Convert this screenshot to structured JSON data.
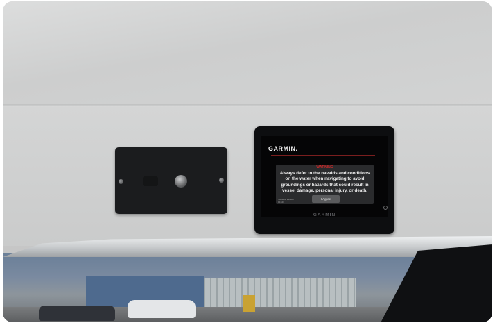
{
  "display": {
    "brand_top": "GARMIN.",
    "warning_title": "WARNING",
    "warning_text": "Always defer to the navaids and conditions on the water when navigating to avoid groundings or hazards that could result in vessel damage, personal injury, or death.",
    "agree_button": "I Agree",
    "software_version": "Software Version 00.10",
    "brand_bottom": "GARMIN"
  },
  "colors": {
    "warning_red": "#d62828",
    "screen_bg": "#050506",
    "dialog_bg": "#2a2b2d",
    "panel_black": "#1b1c1e"
  },
  "icons": [
    "screw-icon",
    "knob-icon",
    "power-icon"
  ]
}
